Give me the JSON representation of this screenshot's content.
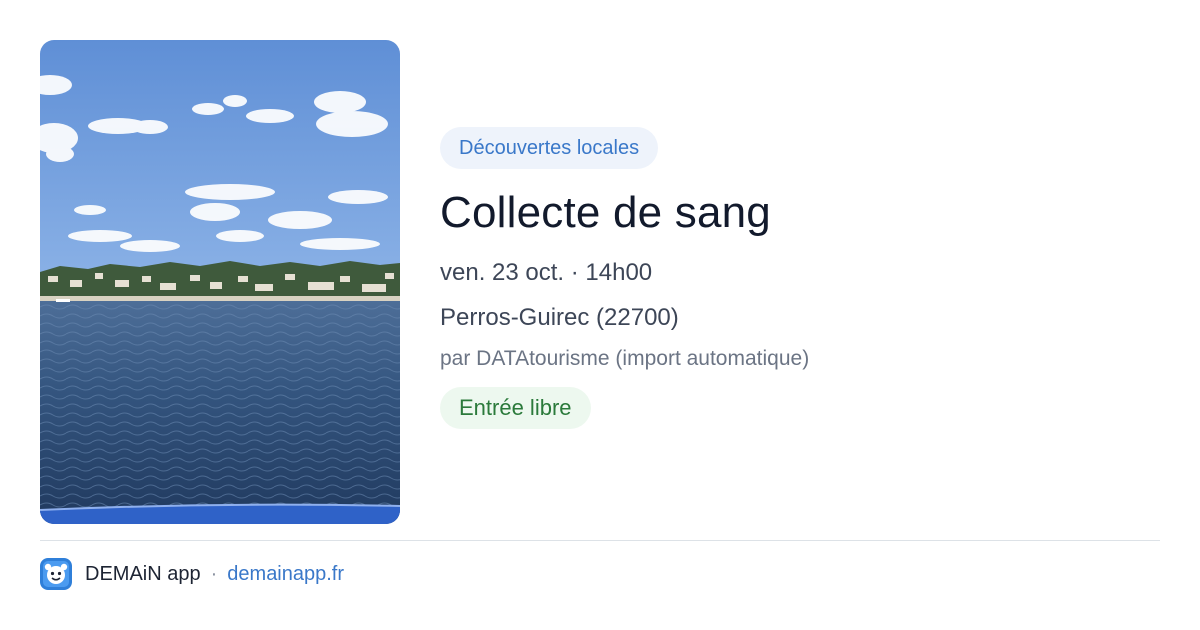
{
  "event": {
    "category": "Découvertes locales",
    "title": "Collecte de sang",
    "datetime": "ven. 23 oct. · 14h00",
    "location": "Perros-Guirec (22700)",
    "organizer": "par DATAtourisme (import automatique)",
    "price": "Entrée libre",
    "image_icon": "seaside-photo"
  },
  "footer": {
    "app_icon": "demain-app-icon",
    "app_name": "DEMAiN app",
    "separator": "·",
    "site": "demainapp.fr"
  },
  "colors": {
    "category_text": "#3a78c9",
    "category_bg": "#eef3fb",
    "title": "#121a2c",
    "price_text": "#2b7a3b",
    "price_bg": "#edf8ef",
    "link": "#3a78c9"
  }
}
